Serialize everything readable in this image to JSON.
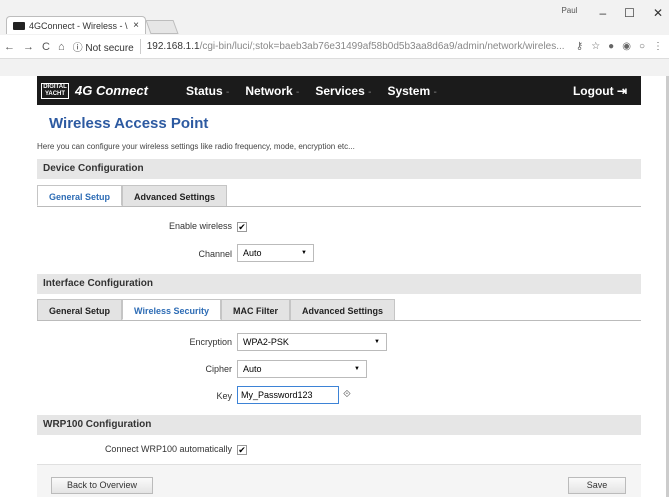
{
  "browser": {
    "tab_title": "4GConnect - Wireless - \\",
    "tab_close": "×",
    "user_badge": "Paul",
    "win_min": "–",
    "win_max": "☐",
    "win_close": "✕",
    "nav_back": "←",
    "nav_forward": "→",
    "nav_reload": "C",
    "nav_home": "⌂",
    "secure_label": "ⓘ Not secure",
    "url_host": "192.168.1.1",
    "url_path": "/cgi-bin/luci/;stok=baeb3ab76e31499af58b0d5b3aa8d6a9/admin/network/wireles...",
    "key_icon": "⚷",
    "star_icon": "☆"
  },
  "navbar": {
    "logo_top": "DIGITAL",
    "logo_bottom": "YACHT",
    "brand": "4G Connect",
    "menu": [
      {
        "label": "Status",
        "caret": "-"
      },
      {
        "label": "Network",
        "caret": "-"
      },
      {
        "label": "Services",
        "caret": "-"
      },
      {
        "label": "System",
        "caret": "-"
      }
    ],
    "logout": "Logout"
  },
  "page": {
    "title": "Wireless Access Point",
    "description": "Here you can configure your wireless settings like radio frequency, mode, encryption etc..."
  },
  "device_config": {
    "header": "Device Configuration",
    "tabs": [
      "General Setup",
      "Advanced Settings"
    ],
    "enable_label": "Enable wireless",
    "enable_checked": "✔",
    "channel_label": "Channel",
    "channel_value": "Auto"
  },
  "interface_config": {
    "header": "Interface Configuration",
    "tabs": [
      "General Setup",
      "Wireless Security",
      "MAC Filter",
      "Advanced Settings"
    ],
    "encryption_label": "Encryption",
    "encryption_value": "WPA2-PSK",
    "cipher_label": "Cipher",
    "cipher_value": "Auto",
    "key_label": "Key",
    "key_value": "My_Password123",
    "reveal_icon": "⟐"
  },
  "wrp_config": {
    "header": "WRP100 Configuration",
    "connect_label": "Connect WRP100 automatically",
    "connect_checked": "✔"
  },
  "footer": {
    "back": "Back to Overview",
    "save": "Save"
  },
  "colors": {
    "accent": "#2d6cb5",
    "title": "#2d5aa1",
    "navbar": "#1b1b1b"
  }
}
